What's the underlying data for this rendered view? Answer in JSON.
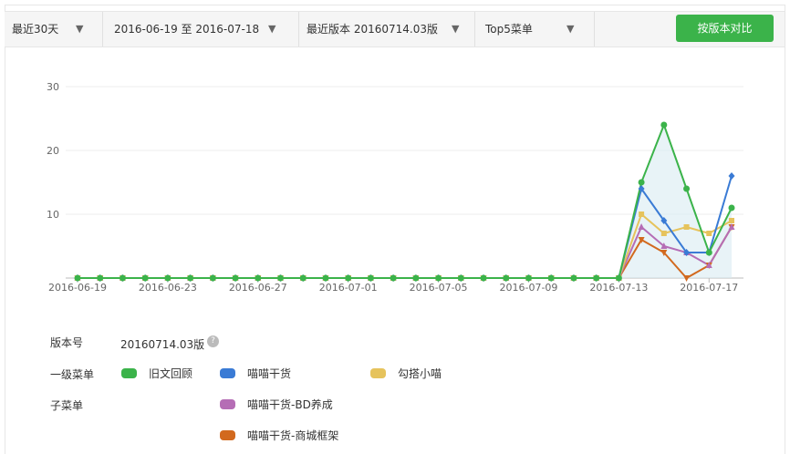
{
  "toolbar": {
    "range_label": "最近30天",
    "date_range": "2016-06-19 至 2016-07-18",
    "version_label": "最近版本 20160714.03版",
    "top_label": "Top5菜单",
    "compare_button": "按版本对比",
    "arrow": "▼"
  },
  "chart_data": {
    "type": "line",
    "x": [
      "2016-06-19",
      "2016-06-20",
      "2016-06-21",
      "2016-06-22",
      "2016-06-23",
      "2016-06-24",
      "2016-06-25",
      "2016-06-26",
      "2016-06-27",
      "2016-06-28",
      "2016-06-29",
      "2016-06-30",
      "2016-07-01",
      "2016-07-02",
      "2016-07-03",
      "2016-07-04",
      "2016-07-05",
      "2016-07-06",
      "2016-07-07",
      "2016-07-08",
      "2016-07-09",
      "2016-07-10",
      "2016-07-11",
      "2016-07-12",
      "2016-07-13",
      "2016-07-14",
      "2016-07-15",
      "2016-07-16",
      "2016-07-17",
      "2016-07-18"
    ],
    "xticks": [
      "2016-06-19",
      "2016-06-23",
      "2016-06-27",
      "2016-07-01",
      "2016-07-05",
      "2016-07-09",
      "2016-07-13",
      "2016-07-17"
    ],
    "yticks": [
      10,
      20,
      30
    ],
    "ylim": [
      0,
      30
    ],
    "series": [
      {
        "name": "旧文回顾",
        "color": "#3bb34a",
        "marker": "circle",
        "area": true,
        "values": [
          0,
          0,
          0,
          0,
          0,
          0,
          0,
          0,
          0,
          0,
          0,
          0,
          0,
          0,
          0,
          0,
          0,
          0,
          0,
          0,
          0,
          0,
          0,
          0,
          0,
          15,
          24,
          14,
          4,
          11
        ]
      },
      {
        "name": "喵喵干货",
        "color": "#3a7bd5",
        "marker": "diamond",
        "values": [
          0,
          0,
          0,
          0,
          0,
          0,
          0,
          0,
          0,
          0,
          0,
          0,
          0,
          0,
          0,
          0,
          0,
          0,
          0,
          0,
          0,
          0,
          0,
          0,
          0,
          14,
          9,
          4,
          4,
          16
        ]
      },
      {
        "name": "勾搭小喵",
        "color": "#e6c35c",
        "marker": "square",
        "values": [
          0,
          0,
          0,
          0,
          0,
          0,
          0,
          0,
          0,
          0,
          0,
          0,
          0,
          0,
          0,
          0,
          0,
          0,
          0,
          0,
          0,
          0,
          0,
          0,
          0,
          10,
          7,
          8,
          7,
          9
        ]
      },
      {
        "name": "喵喵干货-BD养成",
        "color": "#b56db5",
        "marker": "triangle-up",
        "values": [
          0,
          0,
          0,
          0,
          0,
          0,
          0,
          0,
          0,
          0,
          0,
          0,
          0,
          0,
          0,
          0,
          0,
          0,
          0,
          0,
          0,
          0,
          0,
          0,
          0,
          8,
          5,
          4,
          2,
          8
        ]
      },
      {
        "name": "喵喵干货-商城框架",
        "color": "#d2691e",
        "marker": "triangle-down",
        "values": [
          0,
          0,
          0,
          0,
          0,
          0,
          0,
          0,
          0,
          0,
          0,
          0,
          0,
          0,
          0,
          0,
          0,
          0,
          0,
          0,
          0,
          0,
          0,
          0,
          0,
          6,
          4,
          0,
          2,
          8
        ]
      }
    ]
  },
  "info": {
    "version_label": "版本号",
    "version_value": "20160714.03版",
    "help_icon": "?",
    "level1_label": "一级菜单",
    "sub_label": "子菜单"
  },
  "legend": {
    "level1": [
      {
        "name": "旧文回顾",
        "color": "#3bb34a"
      },
      {
        "name": "喵喵干货",
        "color": "#3a7bd5"
      },
      {
        "name": "勾搭小喵",
        "color": "#e6c35c"
      }
    ],
    "sub": [
      {
        "name": "喵喵干货-BD养成",
        "color": "#b56db5"
      },
      {
        "name": "喵喵干货-商城框架",
        "color": "#d2691e"
      }
    ]
  }
}
